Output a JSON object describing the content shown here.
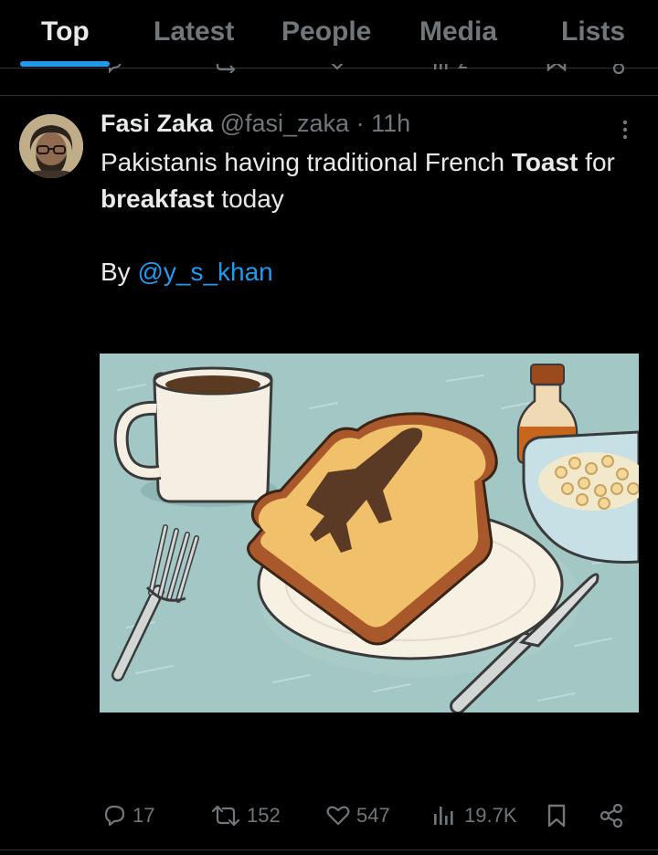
{
  "tabs": [
    {
      "label": "Top",
      "active": true
    },
    {
      "label": "Latest",
      "active": false
    },
    {
      "label": "People",
      "active": false
    },
    {
      "label": "Media",
      "active": false
    },
    {
      "label": "Lists",
      "active": false
    }
  ],
  "tweet": {
    "author_name": "Fasi Zaka",
    "author_handle": "@fasi_zaka",
    "separator": "·",
    "time": "11h",
    "text_part1": "Pakistanis having traditional French ",
    "text_bold1": "Toast",
    "text_part2": " for ",
    "text_bold2": "breakfast",
    "text_part3": " today",
    "by_label": "By ",
    "mention": "@y_s_khan",
    "replies": "17",
    "reposts": "152",
    "likes": "547",
    "views": "19.7K"
  },
  "icons": {
    "more": "more-vertical-icon",
    "reply": "reply-icon",
    "repost": "repost-icon",
    "like": "heart-icon",
    "views": "views-icon",
    "bookmark": "bookmark-icon",
    "share": "share-icon"
  },
  "colors": {
    "background": "#000000",
    "accent": "#1d9bf0",
    "text": "#e7e9ea",
    "muted": "#71767b"
  }
}
